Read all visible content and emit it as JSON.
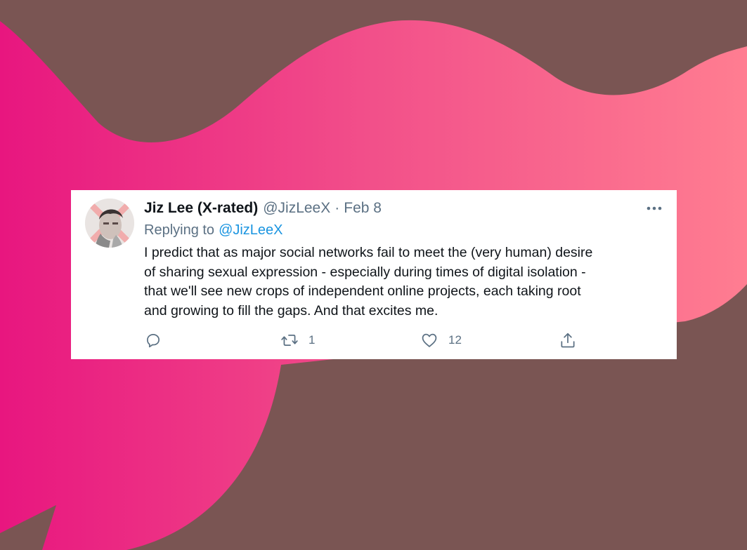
{
  "background": {
    "base_color": "#7a5553",
    "gradient_start": "#e8167f",
    "gradient_mid": "#f2508a",
    "gradient_end": "#ff7d91"
  },
  "tweet": {
    "display_name": "Jiz Lee (X-rated)",
    "handle": "@JizLeeX",
    "separator": "·",
    "date": "Feb 8",
    "reply_prefix": "Replying to",
    "reply_to": "@JizLeeX",
    "text_lines": [
      "I predict that as major social networks fail to meet the (very human) desire",
      "of sharing sexual expression - especially during times of digital isolation -",
      "that we'll see new crops of independent online projects, each taking root",
      "and growing to fill the gaps. And that excites me."
    ],
    "reply_count": "",
    "retweet_count": "1",
    "like_count": "12",
    "icons": {
      "avatar": "avatar-photo",
      "more": "more-icon",
      "reply": "reply-icon",
      "retweet": "retweet-icon",
      "like": "heart-icon",
      "share": "share-icon"
    },
    "colors": {
      "name": "#0f1419",
      "secondary": "#5b7083",
      "mention": "#1b95e0"
    }
  }
}
